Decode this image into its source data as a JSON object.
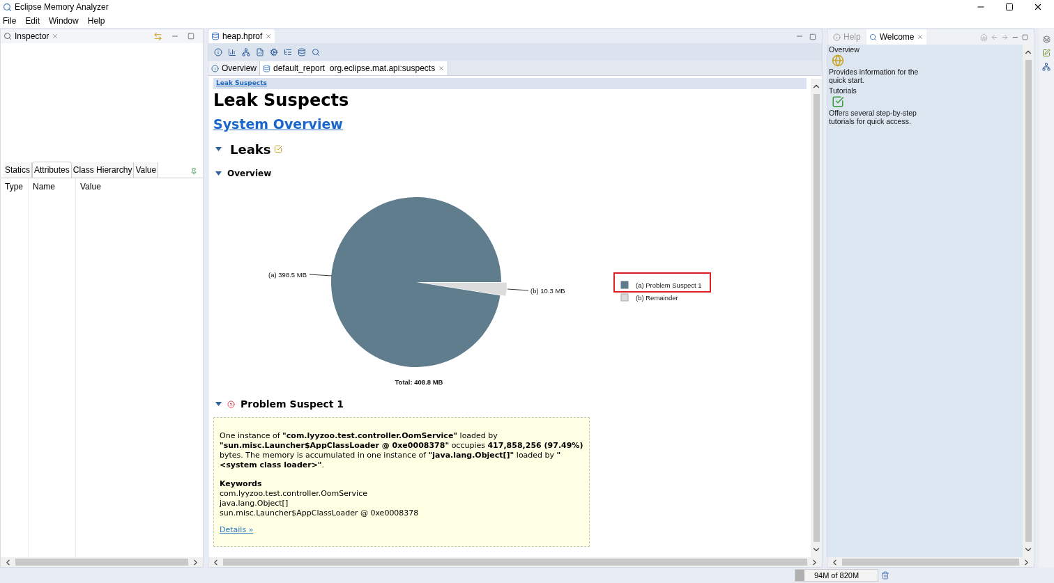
{
  "window": {
    "title": "Eclipse Memory Analyzer"
  },
  "menu": [
    "File",
    "Edit",
    "Window",
    "Help"
  ],
  "inspector": {
    "tab": "Inspector",
    "tabs": [
      {
        "label": "Statics",
        "selected": false
      },
      {
        "label": "Attributes",
        "selected": true
      },
      {
        "label": "Class Hierarchy",
        "selected": false
      },
      {
        "label": "Value",
        "selected": false
      }
    ],
    "columns": [
      "Type",
      "Name",
      "Value"
    ]
  },
  "editor": {
    "tab": "heap.hprof",
    "subtabs": [
      {
        "label": "Overview",
        "selected": false
      },
      {
        "label": "default_report  org.eclipse.mat.api:suspects",
        "selected": true
      }
    ],
    "report": {
      "breadcrumb": "Leak Suspects",
      "title": "Leak Suspects",
      "link": "System Overview",
      "section": "Leaks",
      "subsection": "Overview",
      "chart_data": {
        "type": "pie",
        "title": "Total: 408.8 MB",
        "categories": [
          "(a)  Problem Suspect 1",
          "(b)  Remainder"
        ],
        "values": [
          398.5,
          10.3
        ],
        "colors": [
          "#5f7d8c",
          "#dcdcdc"
        ],
        "legend": "right",
        "data_labels": "value_labels",
        "value_labels": [
          "(a)  398.5 MB",
          "(b)  10.3 MB"
        ]
      },
      "legend_frames": [
        {
          "highlighted": true
        },
        {
          "highlighted": false
        }
      ],
      "suspect": {
        "title": "Problem Suspect 1",
        "text": "One instance of **\"com.lyyzoo.test.controller.OomService\"** loaded by **\"sun.misc.Launcher$AppClassLoader @ 0xe0008378\"** occupies **417,858,256 (97.49%)** bytes. The memory is accumulated in one instance of **\"java.lang.Object[]\"** loaded by **\"<system class loader>\"**.",
        "keywords_title": "Keywords",
        "keywords": [
          "com.lyyzoo.test.controller.OomService",
          "java.lang.Object[]",
          "sun.misc.Launcher$AppClassLoader @ 0xe0008378"
        ],
        "details": "Details »"
      }
    }
  },
  "welcome": {
    "tabs": [
      {
        "label": "Help",
        "selected": false
      },
      {
        "label": "Welcome",
        "selected": true
      }
    ],
    "items": [
      {
        "title": "Overview",
        "description": "Provides information for the quick start."
      },
      {
        "title": "Tutorials",
        "description": "Offers several step-by-step tutorials for quick access."
      }
    ]
  },
  "status_bar": {
    "memory": "94M of 820M",
    "level": 0.11
  }
}
